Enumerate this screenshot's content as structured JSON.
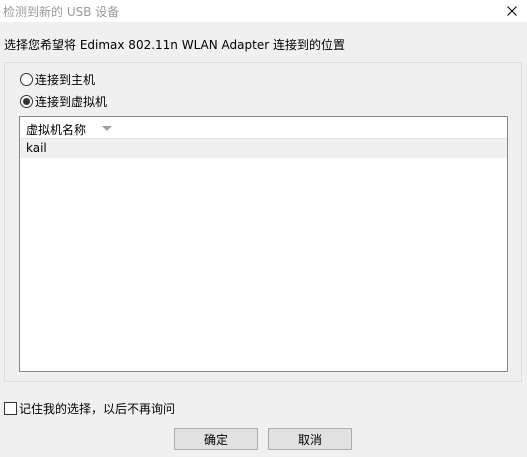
{
  "window": {
    "title": "检测到新的 USB 设备",
    "close_icon": "close-icon"
  },
  "instruction": "选择您希望将 Edimax 802.11n WLAN Adapter 连接到的位置",
  "options": {
    "host_label": "连接到主机",
    "vm_label": "连接到虚拟机",
    "selected": "vm"
  },
  "vm_list": {
    "column_header": "虚拟机名称",
    "sort_icon": "sort-descending-icon",
    "rows": [
      "kail"
    ]
  },
  "remember_label": "记住我的选择，以后不再询问",
  "buttons": {
    "ok_label": "确定",
    "cancel_label": "取消"
  }
}
